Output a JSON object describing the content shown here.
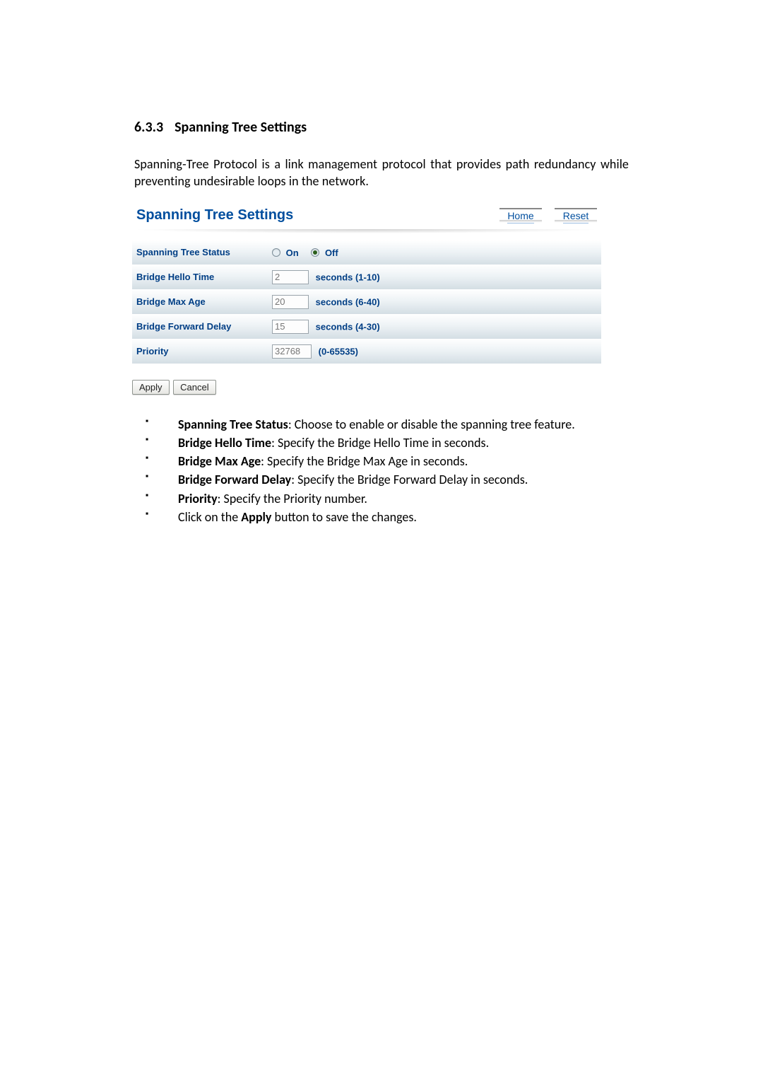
{
  "heading": {
    "num": "6.3.3",
    "title": "Spanning Tree Settings"
  },
  "intro": "Spanning-Tree Protocol is a link management protocol that provides path redundancy while preventing undesirable loops in the network.",
  "panel": {
    "title": "Spanning Tree Settings",
    "home": "Home",
    "reset": "Reset",
    "rows": {
      "status": {
        "label": "Spanning Tree Status",
        "on": "On",
        "off": "Off",
        "selected": "off"
      },
      "hello": {
        "label": "Bridge Hello Time",
        "value": "2",
        "hint": "seconds (1-10)"
      },
      "maxage": {
        "label": "Bridge Max Age",
        "value": "20",
        "hint": "seconds (6-40)"
      },
      "fwd": {
        "label": "Bridge Forward Delay",
        "value": "15",
        "hint": "seconds (4-30)"
      },
      "prio": {
        "label": "Priority",
        "value": "32768",
        "hint": "(0-65535)"
      }
    },
    "apply": "Apply",
    "cancel": "Cancel"
  },
  "bullets": [
    {
      "term": "Spanning Tree Status",
      "desc": ": Choose to enable or disable the spanning tree feature."
    },
    {
      "term": "Bridge Hello Time",
      "desc": ": Specify the Bridge Hello Time in seconds."
    },
    {
      "term": "Bridge Max Age",
      "desc": ": Specify the Bridge Max Age in seconds."
    },
    {
      "term": "Bridge Forward Delay",
      "desc": ": Specify the Bridge Forward Delay in seconds."
    },
    {
      "term": "Priority",
      "desc": ": Specify the Priority number."
    },
    {
      "term_prefix": "Click on the ",
      "term": "Apply",
      "desc": " button to save the changes."
    }
  ]
}
